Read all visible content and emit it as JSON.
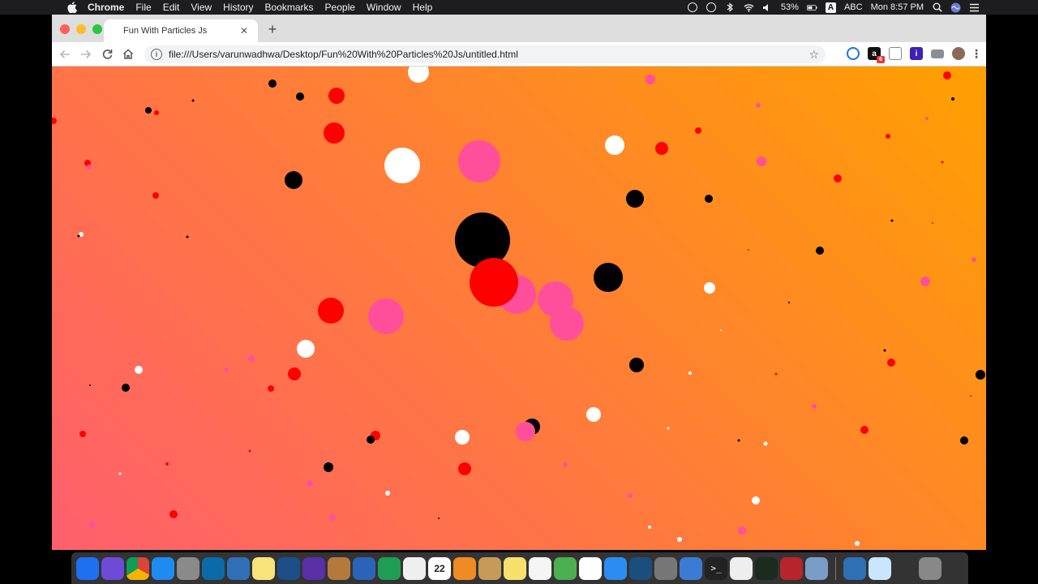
{
  "menubar": {
    "app_name": "Chrome",
    "menus": [
      "File",
      "Edit",
      "View",
      "History",
      "Bookmarks",
      "People",
      "Window",
      "Help"
    ],
    "battery": "53%",
    "input_source": "ABC",
    "clock": "Mon 8:57 PM"
  },
  "browser": {
    "tab_title": "Fun With Particles Js",
    "url": "file:///Users/varunwadhwa/Desktop/Fun%20With%20Particles%20Js/untitled.html",
    "extension_badge": "6"
  },
  "page": {
    "background_gradient": [
      "#ff5f6d",
      "#ff7a3d",
      "#ffa000"
    ],
    "particle_colors": [
      "#000000",
      "#ff0000",
      "#ff4f9a",
      "#ffffff"
    ]
  },
  "dock": {
    "icons": [
      "finder-icon",
      "siri-icon",
      "chrome-icon",
      "safari-icon",
      "launchpad-icon",
      "mysql-workbench-icon",
      "virtualbox-icon",
      "stickies-icon",
      "quicktime-icon",
      "imovie-icon",
      "notebook-icon",
      "keynote-icon",
      "numbers-icon",
      "textedit-icon",
      "calendar-icon",
      "sublime-text-icon",
      "preview-icon",
      "notes-icon",
      "pages-icon",
      "maps-icon",
      "photos-icon",
      "app-store-icon",
      "amazon-music-icon",
      "system-preferences-icon",
      "preview-app-icon",
      "terminal-icon",
      "scripts-icon",
      "activity-monitor-icon",
      "dictionary-icon",
      "photo-viewer-icon",
      "virtualbox-2-icon",
      "xcode-helper-icon",
      "printer-icon",
      "trash-icon"
    ],
    "calendar_day": "22"
  }
}
